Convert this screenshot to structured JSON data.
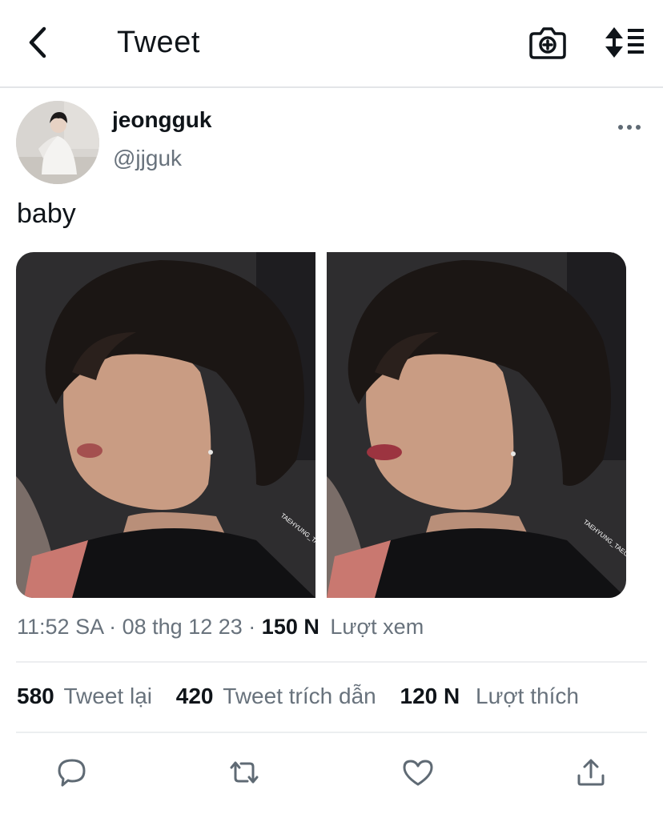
{
  "header": {
    "title": "Tweet",
    "back_icon": "chevron-left-icon",
    "camera_icon": "camera-plus-icon",
    "sort_icon": "sort-icon"
  },
  "tweet": {
    "display_name": "jeongguk",
    "handle": "@jjguk",
    "text": "baby",
    "media": [
      {
        "kind": "photo",
        "watermark": "TAEHYUNG_TAEGGE"
      },
      {
        "kind": "photo",
        "watermark": "TAEHYUNG_TAEGGE"
      }
    ],
    "time": "11:52 SA",
    "sep1": "·",
    "date": "08 thg 12 23",
    "sep2": "·",
    "views_count": "150 N",
    "views_label": "Lượt xem"
  },
  "stats": {
    "retweets_count": "580",
    "retweets_label": "Tweet lại",
    "quotes_count": "420",
    "quotes_label": "Tweet trích dẫn",
    "likes_count": "120 N",
    "likes_label": "Lượt thích"
  },
  "actions": [
    "reply-icon",
    "retweet-icon",
    "like-icon",
    "share-icon"
  ],
  "colors": {
    "text": "#0f1419",
    "secondary": "#68727c",
    "divider": "#eceef0"
  }
}
